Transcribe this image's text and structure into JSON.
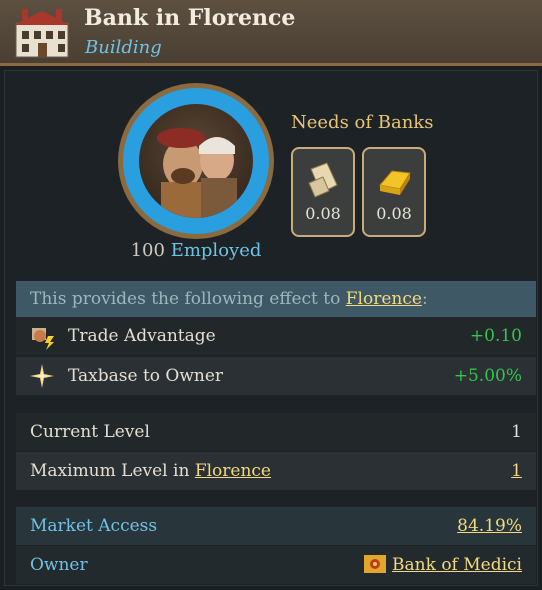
{
  "header": {
    "title": "Bank in Florence",
    "subtitle": "Building"
  },
  "employment": {
    "count": "100",
    "label": "Employed"
  },
  "needs": {
    "title": "Needs of Banks",
    "items": [
      {
        "icon": "paper-scroll-icon",
        "value": "0.08"
      },
      {
        "icon": "gold-bar-icon",
        "value": "0.08"
      }
    ]
  },
  "effect": {
    "prefix": "This provides the following effect to ",
    "target": "Florence",
    "suffix": ":",
    "rows": [
      {
        "icon": "trade-advantage-icon",
        "label": "Trade Advantage",
        "value": "+0.10"
      },
      {
        "icon": "taxbase-star-icon",
        "label": "Taxbase to Owner",
        "value": "+5.00%"
      }
    ]
  },
  "levels": {
    "current_label": "Current Level",
    "current_value": "1",
    "max_label_prefix": "Maximum Level in ",
    "max_label_link": "Florence",
    "max_value": "1"
  },
  "market": {
    "access_label": "Market Access",
    "access_value": "84.19%",
    "owner_label": "Owner",
    "owner_value": "Bank of Medici"
  },
  "colors": {
    "accent_blue": "#6fc3e6",
    "gold": "#f3d97f",
    "positive": "#35c44c"
  }
}
